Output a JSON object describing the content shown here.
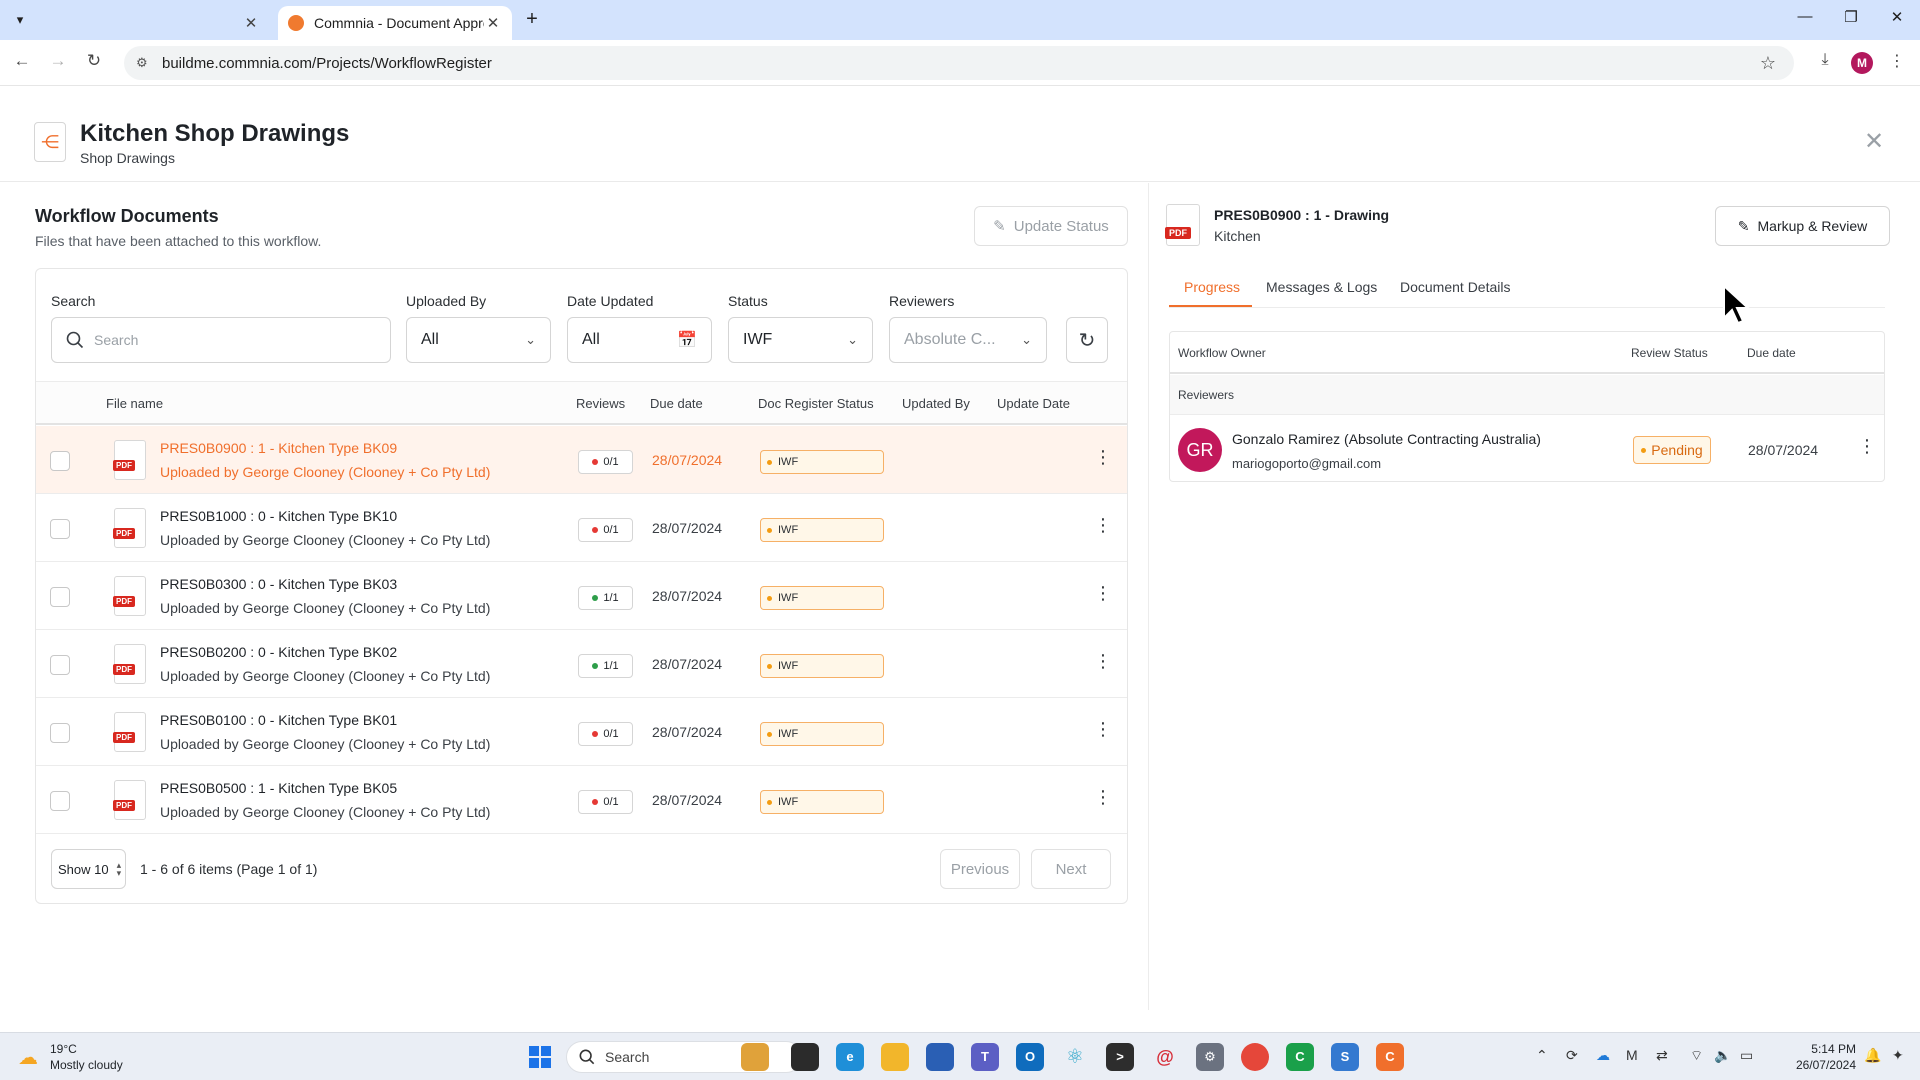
{
  "browser": {
    "tabs": [
      {
        "title": ""
      },
      {
        "title": "Commnia - Document Approval"
      }
    ],
    "url": "buildme.commnia.com/Projects/WorkflowRegister",
    "profile_initial": "M"
  },
  "header": {
    "title": "Kitchen Shop Drawings",
    "subtitle": "Shop Drawings"
  },
  "workflow_docs": {
    "title": "Workflow Documents",
    "subtitle": "Files that have been attached to this workflow.",
    "update_status_label": "Update Status",
    "filters": {
      "search_label": "Search",
      "search_placeholder": "Search",
      "uploaded_by_label": "Uploaded By",
      "uploaded_by_value": "All",
      "date_updated_label": "Date Updated",
      "date_updated_value": "All",
      "status_label": "Status",
      "status_value": "IWF",
      "reviewers_label": "Reviewers",
      "reviewers_value": "Absolute C..."
    },
    "columns": {
      "file_name": "File name",
      "reviews": "Reviews",
      "due_date": "Due date",
      "doc_register_status": "Doc Register Status",
      "updated_by": "Updated By",
      "update_date": "Update Date"
    },
    "rows": [
      {
        "name": "PRES0B0900 : 1 - Kitchen Type BK09",
        "uploaded_by": "Uploaded by George Clooney (Clooney + Co Pty Ltd)",
        "reviews": "0/1",
        "review_state": "red",
        "due": "28/07/2024",
        "status": "IWF",
        "selected": true
      },
      {
        "name": "PRES0B1000 : 0 - Kitchen Type BK10",
        "uploaded_by": "Uploaded by George Clooney (Clooney + Co Pty Ltd)",
        "reviews": "0/1",
        "review_state": "red",
        "due": "28/07/2024",
        "status": "IWF",
        "selected": false
      },
      {
        "name": "PRES0B0300 : 0 - Kitchen Type BK03",
        "uploaded_by": "Uploaded by George Clooney (Clooney + Co Pty Ltd)",
        "reviews": "1/1",
        "review_state": "green",
        "due": "28/07/2024",
        "status": "IWF",
        "selected": false
      },
      {
        "name": "PRES0B0200 : 0 - Kitchen Type BK02",
        "uploaded_by": "Uploaded by George Clooney (Clooney + Co Pty Ltd)",
        "reviews": "1/1",
        "review_state": "green",
        "due": "28/07/2024",
        "status": "IWF",
        "selected": false
      },
      {
        "name": "PRES0B0100 : 0 - Kitchen Type BK01",
        "uploaded_by": "Uploaded by George Clooney (Clooney + Co Pty Ltd)",
        "reviews": "0/1",
        "review_state": "red",
        "due": "28/07/2024",
        "status": "IWF",
        "selected": false
      },
      {
        "name": "PRES0B0500 : 1 - Kitchen Type BK05",
        "uploaded_by": "Uploaded by George Clooney (Clooney + Co Pty Ltd)",
        "reviews": "0/1",
        "review_state": "red",
        "due": "28/07/2024",
        "status": "IWF",
        "selected": false
      }
    ],
    "pager": {
      "show_label": "Show 10",
      "info": "1 - 6 of 6 items (Page 1 of 1)",
      "previous": "Previous",
      "next": "Next"
    },
    "pdf_label": "PDF"
  },
  "detail": {
    "title": "PRES0B0900 : 1 - Drawing",
    "subtitle": "Kitchen",
    "markup_label": "Markup & Review",
    "tabs": [
      "Progress",
      "Messages & Logs",
      "Document Details"
    ],
    "active_tab": "Progress",
    "table": {
      "col_owner": "Workflow Owner",
      "col_review_status": "Review Status",
      "col_due": "Due date",
      "group": "Reviewers",
      "reviewer": {
        "initials": "GR",
        "name": "Gonzalo Ramirez (Absolute Contracting Australia)",
        "email": "mariogoporto@gmail.com",
        "status": "Pending",
        "due": "28/07/2024"
      }
    }
  },
  "taskbar": {
    "weather_temp": "19°C",
    "weather_desc": "Mostly cloudy",
    "search_label": "Search",
    "time": "5:14 PM",
    "date": "26/07/2024"
  },
  "colors": {
    "accent": "#f06f2c",
    "pending": "#f39c12",
    "avatar": "#c2185b"
  }
}
